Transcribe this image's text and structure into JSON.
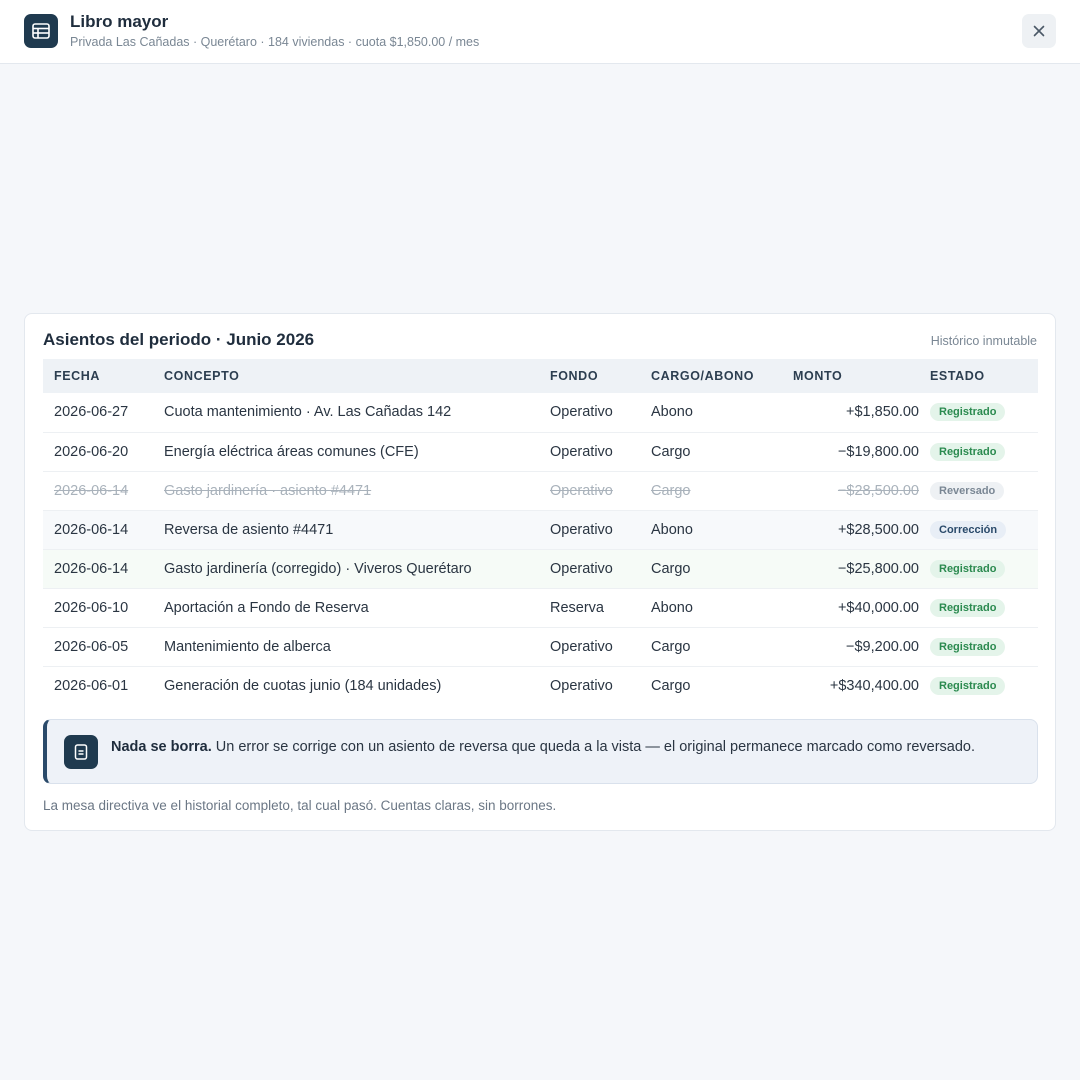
{
  "header": {
    "title": "Libro mayor",
    "subtitle": "Privada Las Cañadas · Querétaro · 184 viviendas · cuota $1,850.00 / mes",
    "app_icon": "table-icon",
    "close_icon": "close-icon"
  },
  "card": {
    "title": "Asientos del periodo · Junio 2026",
    "tag": "Histórico inmutable",
    "columns": [
      "FECHA",
      "CONCEPTO",
      "FONDO",
      "CARGO/ABONO",
      "MONTO",
      "ESTADO"
    ],
    "rows": [
      {
        "fecha": "2026-06-27",
        "concepto": "Cuota mantenimiento · Av. Las Cañadas 142",
        "fondo": "Operativo",
        "tipo": "Abono",
        "monto": "+$1,850.00",
        "estado": "Registrado"
      },
      {
        "fecha": "2026-06-20",
        "concepto": "Energía eléctrica áreas comunes (CFE)",
        "fondo": "Operativo",
        "tipo": "Cargo",
        "monto": "−$19,800.00",
        "estado": "Registrado"
      },
      {
        "fecha": "2026-06-14",
        "concepto": "Gasto jardinería · asiento #4471",
        "fondo": "Operativo",
        "tipo": "Cargo",
        "monto": "−$28,500.00",
        "estado": "Reversado"
      },
      {
        "fecha": "2026-06-14",
        "concepto": "Reversa de asiento #4471",
        "fondo": "Operativo",
        "tipo": "Abono",
        "monto": "+$28,500.00",
        "estado": "Corrección"
      },
      {
        "fecha": "2026-06-14",
        "concepto": "Gasto jardinería (corregido) · Viveros Querétaro",
        "fondo": "Operativo",
        "tipo": "Cargo",
        "monto": "−$25,800.00",
        "estado": "Registrado"
      },
      {
        "fecha": "2026-06-10",
        "concepto": "Aportación a Fondo de Reserva",
        "fondo": "Reserva",
        "tipo": "Abono",
        "monto": "+$40,000.00",
        "estado": "Registrado"
      },
      {
        "fecha": "2026-06-05",
        "concepto": "Mantenimiento de alberca",
        "fondo": "Operativo",
        "tipo": "Cargo",
        "monto": "−$9,200.00",
        "estado": "Registrado"
      },
      {
        "fecha": "2026-06-01",
        "concepto": "Generación de cuotas junio (184 unidades)",
        "fondo": "Operativo",
        "tipo": "Cargo",
        "monto": "+$340,400.00",
        "estado": "Registrado"
      }
    ]
  },
  "notice": {
    "icon": "document-icon",
    "strong": "Nada se borra.",
    "text": " Un error se corrige con un asiento de reversa que queda a la vista — el original permanece marcado como reversado."
  },
  "footnote": "La mesa directiva ve el historial completo, tal cual pasó. Cuentas claras, sin borrones.",
  "colors": {
    "brand": "#1f3a4f",
    "positive": "#2b8a4f",
    "negative": "#d0323e",
    "muted": "#7a8794"
  }
}
